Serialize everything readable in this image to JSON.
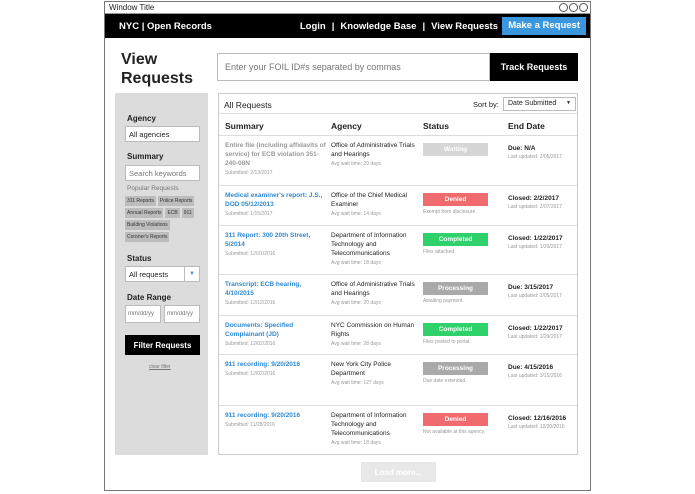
{
  "window": {
    "title": "Window Title"
  },
  "nav": {
    "brand": "NYC | Open Records",
    "links": [
      "Login",
      "Knowledge Base",
      "View Requests"
    ],
    "separator": "|",
    "cta": "Make a Request"
  },
  "page": {
    "title_line1": "View",
    "title_line2": "Requests",
    "search_placeholder": "Enter your FOIL ID#s separated by commas",
    "track_button": "Track Requests"
  },
  "sidebar": {
    "agency_label": "Agency",
    "agency_value": "All agencies",
    "summary_label": "Summary",
    "summary_placeholder": "Search keywords",
    "popular_label": "Popular Requests",
    "tags": [
      "311 Reports",
      "Police Reports",
      "Annual Reports",
      "ECB",
      "911",
      "Building Violations",
      "Coroner's Reports"
    ],
    "status_label": "Status",
    "status_value": "All requests",
    "date_label": "Date Range",
    "date_from_placeholder": "mm/dd/yy",
    "date_to_placeholder": "mm/dd/yy",
    "filter_button": "Filter Requests",
    "clear_link": "clear filter"
  },
  "table": {
    "title": "All Requests",
    "sort_label": "Sort by:",
    "sort_value": "Date Submitted",
    "columns": [
      "Summary",
      "Agency",
      "Status",
      "End Date"
    ],
    "rows": [
      {
        "summary": "Entire file (including affidavits of service) for ECB violation 351-240-08N",
        "submitted": "Submitted: 2/13/2017",
        "agency": "Office of Administrative Trials and Hearings",
        "wait": "Avg wait time: 20 days",
        "status": "Waiting",
        "note": "",
        "end": "Due: N/A",
        "updated": "Last updated: 2/05/2017"
      },
      {
        "summary": "Medical examiner's report: J.S., DOD 05/12/2013",
        "submitted": "Submitted: 1/15/2017",
        "agency": "Office of the Chief Medical Examiner",
        "wait": "Avg wait time: 14 days",
        "status": "Denied",
        "note": "Exempt from disclosure.",
        "end": "Closed: 2/2/2017",
        "updated": "Last updated: 2/07/2017"
      },
      {
        "summary": "311 Report: 300 20th Street, 5/2014",
        "submitted": "Submitted: 12/31/2016",
        "agency": "Department of Information Technology and Telecommunications",
        "wait": "Avg wait time: 18 days",
        "status": "Completed",
        "note": "Files attached.",
        "end": "Closed: 1/22/2017",
        "updated": "Last updated: 1/29/2017"
      },
      {
        "summary": "Transcript: ECB hearing, 4/10/2015",
        "submitted": "Submitted: 12/12/2016",
        "agency": "Office of Administrative Trials and Hearings",
        "wait": "Avg wait time: 20 days",
        "status": "Processing",
        "note": "Awaiting payment.",
        "end": "Due: 3/15/2017",
        "updated": "Last updated: 2/05/2017"
      },
      {
        "summary": "Documents: Specified Complainant (JD)",
        "submitted": "Submitted: 12/02/2016",
        "agency": "NYC Commission on Human Rights",
        "wait": "Avg wait time: 28 days",
        "status": "Completed",
        "note": "Files posted to portal.",
        "end": "Closed: 1/22/2017",
        "updated": "Last updated: 1/29/2017"
      },
      {
        "summary": "911 recording: 9/20/2016",
        "submitted": "Submitted: 12/02/2016",
        "agency": "New York City Police Department",
        "wait": "Avg wait time: 127 days",
        "status": "Processing",
        "note": "Due date extended.",
        "end": "Due: 4/15/2016",
        "updated": "Last updated: 3/15/2016"
      },
      {
        "summary": "911 recording: 9/20/2016",
        "submitted": "Submitted: 11/28/2016",
        "agency": "Department of Information Technology and Telecommunications",
        "wait": "Avg wait time: 18 days",
        "status": "Denied",
        "note": "Not available at this agency.",
        "end": "Closed: 12/16/2016",
        "updated": "Last updated: 12/20/2016"
      }
    ]
  },
  "load_more": "Load more...",
  "colors": {
    "accent": "#3b97dd",
    "waiting": "#d6d6d6",
    "denied": "#f06b6e",
    "completed": "#2fd16a",
    "processing": "#a9a9a9"
  }
}
